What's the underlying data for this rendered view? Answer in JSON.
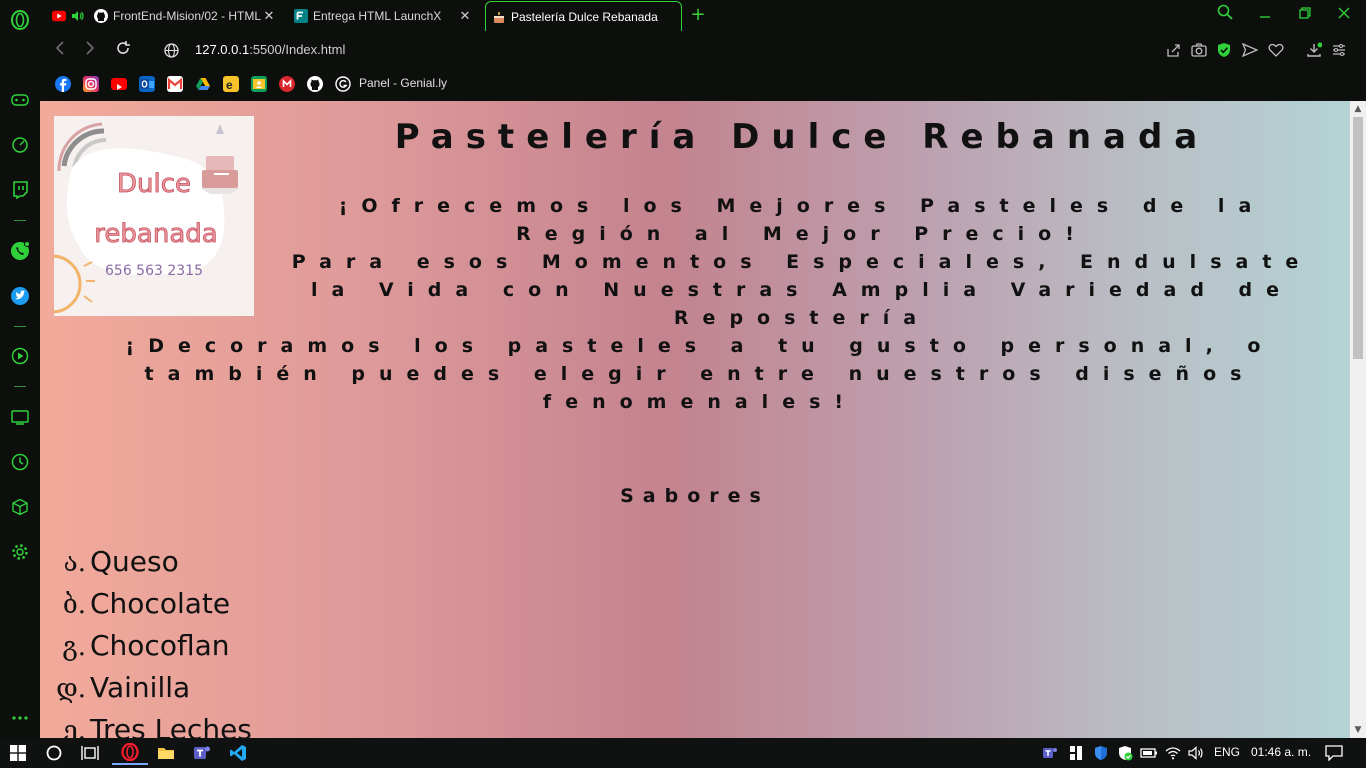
{
  "tabs": [
    {
      "title": "FrontEnd-Mision/02 - HTML",
      "favicon": "github-icon"
    },
    {
      "title": "Entrega HTML LaunchX",
      "favicon": "forms-icon"
    },
    {
      "title": "Pastelería Dulce Rebanada",
      "favicon": "cake-icon"
    }
  ],
  "address": {
    "url_host": "127.0.0.1",
    "url_rest": ":5500/Index.html"
  },
  "bookmarks": {
    "icons": [
      "facebook-icon",
      "instagram-icon",
      "youtube-icon",
      "outlook-icon",
      "gmail-icon",
      "drive-icon",
      "edpuzzle-icon",
      "classroom-icon",
      "mega-icon",
      "github-icon",
      "genially-icon"
    ],
    "label": "Panel - Genial.ly"
  },
  "page": {
    "logo": {
      "line1": "Dulce",
      "line2": "rebanada",
      "phone": "656 563 2315"
    },
    "h1": "Pastelería Dulce Rebanada",
    "h2_line1": "¡Ofrecemos los Mejores Pasteles de la Región al Mejor Precio!",
    "h2_line2": "Para esos Momentos Especiales, Endulsate la Vida con Nuestras Amplia Variedad de Repostería",
    "h3": "¡Decoramos los pasteles a tu gusto personal, o también puedes elegir entre nuestros diseños fenomenales!",
    "flavors_title": "Sabores",
    "flavors": [
      {
        "marker": "ა.",
        "label": "Queso"
      },
      {
        "marker": "ბ.",
        "label": "Chocolate"
      },
      {
        "marker": "გ.",
        "label": "Chocoflan"
      },
      {
        "marker": "დ.",
        "label": "Vainilla"
      },
      {
        "marker": "ე.",
        "label": "Tres Leches"
      }
    ]
  },
  "taskbar": {
    "lang": "ENG",
    "time": "01:46 a. m."
  },
  "colors": {
    "accent": "#2fd13a",
    "chrome_bg": "#0d0f0d",
    "gradient_left": "#f2aa9a",
    "gradient_mid": "#c3838f",
    "gradient_right": "#b3d3d5"
  }
}
